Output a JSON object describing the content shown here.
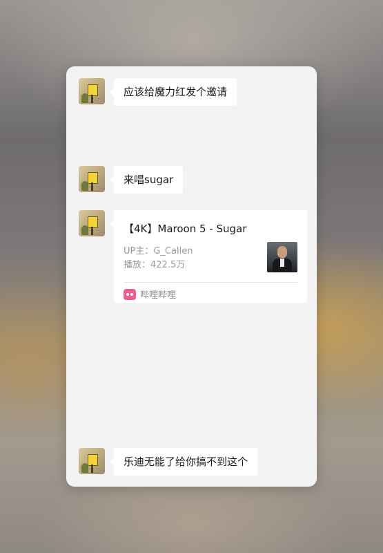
{
  "messages": [
    {
      "type": "text",
      "text": "应该给魔力红发个邀请"
    },
    {
      "type": "text",
      "text": "来唱sugar"
    },
    {
      "type": "share",
      "title": "【4K】Maroon 5 - Sugar",
      "uploader": "UP主：G_Callen",
      "plays": "播放：422.5万",
      "source": "哔哩哔哩",
      "source_icon": "bilibili-icon",
      "thumbnail": "video-thumbnail-man-in-suit"
    },
    {
      "type": "text",
      "text": "乐迪无能了给你搞不到这个"
    }
  ],
  "colors": {
    "card_bg": "#f3f3f3",
    "bubble_bg": "#ffffff",
    "bilibili_pink": "#f05a8d",
    "meta_text": "#9a9a9a"
  }
}
